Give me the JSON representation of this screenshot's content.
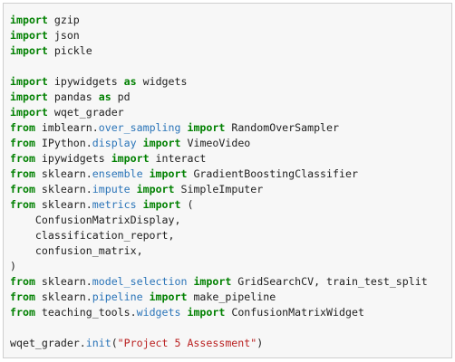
{
  "colors": {
    "keyword": "#008000",
    "attribute": "#2a74b8",
    "string": "#ba2121",
    "text": "#212121",
    "cell_background": "#f7f7f7",
    "cell_border": "#cfcfcf"
  },
  "code_lines": [
    [
      [
        "kw",
        "import"
      ],
      [
        "t",
        " gzip"
      ]
    ],
    [
      [
        "kw",
        "import"
      ],
      [
        "t",
        " json"
      ]
    ],
    [
      [
        "kw",
        "import"
      ],
      [
        "t",
        " pickle"
      ]
    ],
    [],
    [
      [
        "kw",
        "import"
      ],
      [
        "t",
        " ipywidgets "
      ],
      [
        "kw",
        "as"
      ],
      [
        "t",
        " widgets"
      ]
    ],
    [
      [
        "kw",
        "import"
      ],
      [
        "t",
        " pandas "
      ],
      [
        "kw",
        "as"
      ],
      [
        "t",
        " pd"
      ]
    ],
    [
      [
        "kw",
        "import"
      ],
      [
        "t",
        " wqet_grader"
      ]
    ],
    [
      [
        "kw",
        "from"
      ],
      [
        "t",
        " imblearn."
      ],
      [
        "attr",
        "over_sampling"
      ],
      [
        "t",
        " "
      ],
      [
        "kw",
        "import"
      ],
      [
        "t",
        " RandomOverSampler"
      ]
    ],
    [
      [
        "kw",
        "from"
      ],
      [
        "t",
        " IPython."
      ],
      [
        "attr",
        "display"
      ],
      [
        "t",
        " "
      ],
      [
        "kw",
        "import"
      ],
      [
        "t",
        " VimeoVideo"
      ]
    ],
    [
      [
        "kw",
        "from"
      ],
      [
        "t",
        " ipywidgets "
      ],
      [
        "kw",
        "import"
      ],
      [
        "t",
        " interact"
      ]
    ],
    [
      [
        "kw",
        "from"
      ],
      [
        "t",
        " sklearn."
      ],
      [
        "attr",
        "ensemble"
      ],
      [
        "t",
        " "
      ],
      [
        "kw",
        "import"
      ],
      [
        "t",
        " GradientBoostingClassifier"
      ]
    ],
    [
      [
        "kw",
        "from"
      ],
      [
        "t",
        " sklearn."
      ],
      [
        "attr",
        "impute"
      ],
      [
        "t",
        " "
      ],
      [
        "kw",
        "import"
      ],
      [
        "t",
        " SimpleImputer"
      ]
    ],
    [
      [
        "kw",
        "from"
      ],
      [
        "t",
        " sklearn."
      ],
      [
        "attr",
        "metrics"
      ],
      [
        "t",
        " "
      ],
      [
        "kw",
        "import"
      ],
      [
        "t",
        " ("
      ]
    ],
    [
      [
        "t",
        "    ConfusionMatrixDisplay,"
      ]
    ],
    [
      [
        "t",
        "    classification_report,"
      ]
    ],
    [
      [
        "t",
        "    confusion_matrix,"
      ]
    ],
    [
      [
        "t",
        ")"
      ]
    ],
    [
      [
        "kw",
        "from"
      ],
      [
        "t",
        " sklearn."
      ],
      [
        "attr",
        "model_selection"
      ],
      [
        "t",
        " "
      ],
      [
        "kw",
        "import"
      ],
      [
        "t",
        " GridSearchCV, train_test_split"
      ]
    ],
    [
      [
        "kw",
        "from"
      ],
      [
        "t",
        " sklearn."
      ],
      [
        "attr",
        "pipeline"
      ],
      [
        "t",
        " "
      ],
      [
        "kw",
        "import"
      ],
      [
        "t",
        " make_pipeline"
      ]
    ],
    [
      [
        "kw",
        "from"
      ],
      [
        "t",
        " teaching_tools."
      ],
      [
        "attr",
        "widgets"
      ],
      [
        "t",
        " "
      ],
      [
        "kw",
        "import"
      ],
      [
        "t",
        " ConfusionMatrixWidget"
      ]
    ],
    [],
    [
      [
        "t",
        "wqet_grader."
      ],
      [
        "attr",
        "init"
      ],
      [
        "t",
        "("
      ],
      [
        "str",
        "\"Project 5 Assessment\""
      ],
      [
        "t",
        ")"
      ]
    ]
  ]
}
